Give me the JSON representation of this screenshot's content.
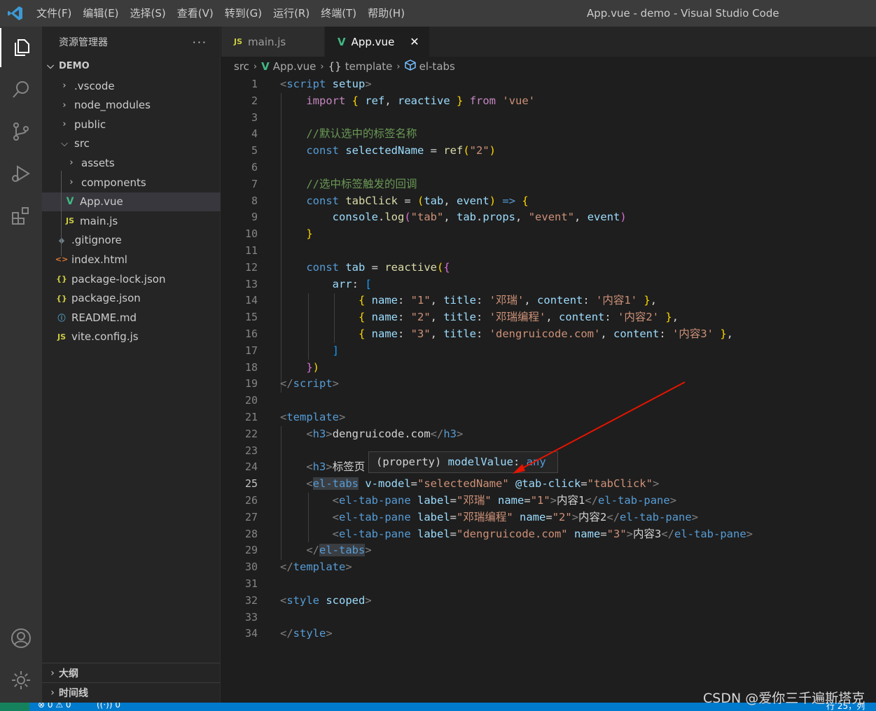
{
  "window": {
    "title": "App.vue - demo - Visual Studio Code"
  },
  "menu": [
    "文件(F)",
    "编辑(E)",
    "选择(S)",
    "查看(V)",
    "转到(G)",
    "运行(R)",
    "终端(T)",
    "帮助(H)"
  ],
  "explorer": {
    "header": "资源管理器",
    "more": "···",
    "root": "DEMO",
    "items": [
      {
        "label": ".vscode",
        "icon": "chevron-right"
      },
      {
        "label": "node_modules",
        "icon": "chevron-right"
      },
      {
        "label": "public",
        "icon": "chevron-right"
      },
      {
        "label": "src",
        "icon": "chevron-down"
      },
      {
        "label": "assets",
        "icon": "chevron-right"
      },
      {
        "label": "components",
        "icon": "chevron-right"
      },
      {
        "label": "App.vue",
        "icon": "vue-icon",
        "glyph": "V"
      },
      {
        "label": "main.js",
        "icon": "js-icon",
        "glyph": "JS"
      },
      {
        "label": ".gitignore",
        "icon": "git-icon",
        "glyph": "◆"
      },
      {
        "label": "index.html",
        "icon": "html-icon",
        "glyph": "<>"
      },
      {
        "label": "package-lock.json",
        "icon": "json-icon",
        "glyph": "{}"
      },
      {
        "label": "package.json",
        "icon": "json-icon",
        "glyph": "{}"
      },
      {
        "label": "README.md",
        "icon": "info-icon",
        "glyph": "ⓘ"
      },
      {
        "label": "vite.config.js",
        "icon": "js-icon",
        "glyph": "JS"
      }
    ],
    "outline": "大纲",
    "timeline": "时间线"
  },
  "tabs": [
    {
      "label": "main.js",
      "glyph": "JS"
    },
    {
      "label": "App.vue",
      "glyph": "V",
      "close": "✕"
    }
  ],
  "breadcrumb": {
    "src": "src",
    "file": "App.vue",
    "scope": "template",
    "element": "el-tabs",
    "scope_glyph": "{}"
  },
  "editor": {
    "current_line": "25",
    "line_numbers": [
      "1",
      "2",
      "3",
      "4",
      "5",
      "6",
      "7",
      "8",
      "9",
      "10",
      "11",
      "12",
      "13",
      "14",
      "15",
      "16",
      "17",
      "18",
      "19",
      "20",
      "21",
      "22",
      "23",
      "24",
      "25",
      "26",
      "27",
      "28",
      "29",
      "30",
      "31",
      "32",
      "33",
      "34"
    ],
    "lines": [
      [
        [
          "c-angle",
          "<"
        ],
        [
          "c-tag",
          "script"
        ],
        [
          "c-attr",
          " setup"
        ],
        [
          "c-angle",
          ">"
        ]
      ],
      [
        [
          "c-text",
          "    "
        ],
        [
          "c-kw",
          "import"
        ],
        [
          "c-text",
          " "
        ],
        [
          "c-br1",
          "{"
        ],
        [
          "c-var",
          " ref"
        ],
        [
          "c-text",
          ","
        ],
        [
          "c-var",
          " reactive"
        ],
        [
          "c-br1",
          " }"
        ],
        [
          "c-kw",
          " from"
        ],
        [
          "c-str",
          " 'vue'"
        ]
      ],
      [],
      [
        [
          "c-com",
          "    //默认选中的标签名称"
        ]
      ],
      [
        [
          "c-key",
          "    const"
        ],
        [
          "c-var",
          " selectedName"
        ],
        [
          "c-text",
          " = "
        ],
        [
          "c-fn",
          "ref"
        ],
        [
          "c-br1",
          "("
        ],
        [
          "c-str",
          "\"2\""
        ],
        [
          "c-br1",
          ")"
        ]
      ],
      [],
      [
        [
          "c-com",
          "    //选中标签触发的回调"
        ]
      ],
      [
        [
          "c-key",
          "    const"
        ],
        [
          "c-fn",
          " tabClick"
        ],
        [
          "c-text",
          " = "
        ],
        [
          "c-br1",
          "("
        ],
        [
          "c-var",
          "tab"
        ],
        [
          "c-text",
          ", "
        ],
        [
          "c-var",
          "event"
        ],
        [
          "c-br1",
          ")"
        ],
        [
          "c-key",
          " =>"
        ],
        [
          "c-br1",
          " {"
        ]
      ],
      [
        [
          "c-var",
          "        console"
        ],
        [
          "c-text",
          "."
        ],
        [
          "c-fn",
          "log"
        ],
        [
          "c-br2",
          "("
        ],
        [
          "c-str",
          "\"tab\""
        ],
        [
          "c-text",
          ", "
        ],
        [
          "c-var",
          "tab"
        ],
        [
          "c-text",
          "."
        ],
        [
          "c-var",
          "props"
        ],
        [
          "c-text",
          ", "
        ],
        [
          "c-str",
          "\"event\""
        ],
        [
          "c-text",
          ", "
        ],
        [
          "c-var",
          "event"
        ],
        [
          "c-br2",
          ")"
        ]
      ],
      [
        [
          "c-br1",
          "    }"
        ]
      ],
      [],
      [
        [
          "c-key",
          "    const"
        ],
        [
          "c-var",
          " tab"
        ],
        [
          "c-text",
          " = "
        ],
        [
          "c-fn",
          "reactive"
        ],
        [
          "c-br1",
          "("
        ],
        [
          "c-br2",
          "{"
        ]
      ],
      [
        [
          "c-var",
          "        arr"
        ],
        [
          "c-text",
          ": "
        ],
        [
          "c-br3",
          "["
        ]
      ],
      [
        [
          "c-br1",
          "            {"
        ],
        [
          "c-var",
          " name"
        ],
        [
          "c-text",
          ": "
        ],
        [
          "c-str",
          "\"1\""
        ],
        [
          "c-text",
          ", "
        ],
        [
          "c-var",
          "title"
        ],
        [
          "c-text",
          ": "
        ],
        [
          "c-str",
          "'邓瑞'"
        ],
        [
          "c-text",
          ", "
        ],
        [
          "c-var",
          "content"
        ],
        [
          "c-text",
          ": "
        ],
        [
          "c-str",
          "'内容1'"
        ],
        [
          "c-br1",
          " }"
        ],
        [
          "c-text",
          ","
        ]
      ],
      [
        [
          "c-br1",
          "            {"
        ],
        [
          "c-var",
          " name"
        ],
        [
          "c-text",
          ": "
        ],
        [
          "c-str",
          "\"2\""
        ],
        [
          "c-text",
          ", "
        ],
        [
          "c-var",
          "title"
        ],
        [
          "c-text",
          ": "
        ],
        [
          "c-str",
          "'邓瑞编程'"
        ],
        [
          "c-text",
          ", "
        ],
        [
          "c-var",
          "content"
        ],
        [
          "c-text",
          ": "
        ],
        [
          "c-str",
          "'内容2'"
        ],
        [
          "c-br1",
          " }"
        ],
        [
          "c-text",
          ","
        ]
      ],
      [
        [
          "c-br1",
          "            {"
        ],
        [
          "c-var",
          " name"
        ],
        [
          "c-text",
          ": "
        ],
        [
          "c-str",
          "\"3\""
        ],
        [
          "c-text",
          ", "
        ],
        [
          "c-var",
          "title"
        ],
        [
          "c-text",
          ": "
        ],
        [
          "c-str",
          "'dengruicode.com'"
        ],
        [
          "c-text",
          ", "
        ],
        [
          "c-var",
          "content"
        ],
        [
          "c-text",
          ": "
        ],
        [
          "c-str",
          "'内容3'"
        ],
        [
          "c-br1",
          " }"
        ],
        [
          "c-text",
          ","
        ]
      ],
      [
        [
          "c-br3",
          "        ]"
        ]
      ],
      [
        [
          "c-br2",
          "    }"
        ],
        [
          "c-br1",
          ")"
        ]
      ],
      [
        [
          "c-angle",
          "</"
        ],
        [
          "c-tag",
          "script"
        ],
        [
          "c-angle",
          ">"
        ]
      ],
      [],
      [
        [
          "c-angle",
          "<"
        ],
        [
          "c-tag",
          "template"
        ],
        [
          "c-angle",
          ">"
        ]
      ],
      [
        [
          "c-text",
          "    "
        ],
        [
          "c-angle",
          "<"
        ],
        [
          "c-tag",
          "h3"
        ],
        [
          "c-angle",
          ">"
        ],
        [
          "c-text",
          "dengruicode.com"
        ],
        [
          "c-angle",
          "</"
        ],
        [
          "c-tag",
          "h3"
        ],
        [
          "c-angle",
          ">"
        ]
      ],
      [],
      [
        [
          "c-text",
          "    "
        ],
        [
          "c-angle",
          "<"
        ],
        [
          "c-tag",
          "h3"
        ],
        [
          "c-angle",
          ">"
        ],
        [
          "c-text",
          "标签页"
        ]
      ],
      [
        [
          "c-text",
          "    "
        ],
        [
          "c-angle",
          "<"
        ],
        [
          "c-tag-hl",
          "el-tabs"
        ],
        [
          "c-attr",
          " v-model"
        ],
        [
          "c-text",
          "="
        ],
        [
          "c-str",
          "\"selectedName\""
        ],
        [
          "c-attr",
          " @tab-click"
        ],
        [
          "c-text",
          "="
        ],
        [
          "c-str",
          "\"tabClick\""
        ],
        [
          "c-angle",
          ">"
        ]
      ],
      [
        [
          "c-text",
          "        "
        ],
        [
          "c-angle",
          "<"
        ],
        [
          "c-tag",
          "el-tab-pane"
        ],
        [
          "c-attr",
          " label"
        ],
        [
          "c-text",
          "="
        ],
        [
          "c-str",
          "\"邓瑞\""
        ],
        [
          "c-attr",
          " name"
        ],
        [
          "c-text",
          "="
        ],
        [
          "c-str",
          "\"1\""
        ],
        [
          "c-angle",
          ">"
        ],
        [
          "c-text",
          "内容1"
        ],
        [
          "c-angle",
          "</"
        ],
        [
          "c-tag",
          "el-tab-pane"
        ],
        [
          "c-angle",
          ">"
        ]
      ],
      [
        [
          "c-text",
          "        "
        ],
        [
          "c-angle",
          "<"
        ],
        [
          "c-tag",
          "el-tab-pane"
        ],
        [
          "c-attr",
          " label"
        ],
        [
          "c-text",
          "="
        ],
        [
          "c-str",
          "\"邓瑞编程\""
        ],
        [
          "c-attr",
          " name"
        ],
        [
          "c-text",
          "="
        ],
        [
          "c-str",
          "\"2\""
        ],
        [
          "c-angle",
          ">"
        ],
        [
          "c-text",
          "内容2"
        ],
        [
          "c-angle",
          "</"
        ],
        [
          "c-tag",
          "el-tab-pane"
        ],
        [
          "c-angle",
          ">"
        ]
      ],
      [
        [
          "c-text",
          "        "
        ],
        [
          "c-angle",
          "<"
        ],
        [
          "c-tag",
          "el-tab-pane"
        ],
        [
          "c-attr",
          " label"
        ],
        [
          "c-text",
          "="
        ],
        [
          "c-str",
          "\"dengruicode.com\""
        ],
        [
          "c-attr",
          " name"
        ],
        [
          "c-text",
          "="
        ],
        [
          "c-str",
          "\"3\""
        ],
        [
          "c-angle",
          ">"
        ],
        [
          "c-text",
          "内容3"
        ],
        [
          "c-angle",
          "</"
        ],
        [
          "c-tag",
          "el-tab-pane"
        ],
        [
          "c-angle",
          ">"
        ]
      ],
      [
        [
          "c-text",
          "    "
        ],
        [
          "c-angle",
          "</"
        ],
        [
          "c-tag-hl",
          "el-tabs"
        ],
        [
          "c-angle",
          ">"
        ]
      ],
      [
        [
          "c-angle",
          "</"
        ],
        [
          "c-tag",
          "template"
        ],
        [
          "c-angle",
          ">"
        ]
      ],
      [],
      [
        [
          "c-angle",
          "<"
        ],
        [
          "c-tag",
          "style"
        ],
        [
          "c-attr",
          " scoped"
        ],
        [
          "c-angle",
          ">"
        ]
      ],
      [],
      [
        [
          "c-angle",
          "</"
        ],
        [
          "c-tag",
          "style"
        ],
        [
          "c-angle",
          ">"
        ]
      ]
    ]
  },
  "hover": [
    [
      "c-text",
      "(property) "
    ],
    [
      "c-var",
      "modelValue"
    ],
    [
      "c-text",
      ": "
    ],
    [
      "c-key",
      "any"
    ]
  ],
  "status": {
    "problems": "⊗ 0 ⚠ 0",
    "ports": "((·)) 0",
    "position": "行 25，列"
  },
  "watermark": "CSDN @爱你三千遍斯塔克",
  "colors": {
    "accent": "#007acc",
    "vue": "#41b883",
    "js": "#cbcb41",
    "annotation_arrow": "#e51400"
  }
}
